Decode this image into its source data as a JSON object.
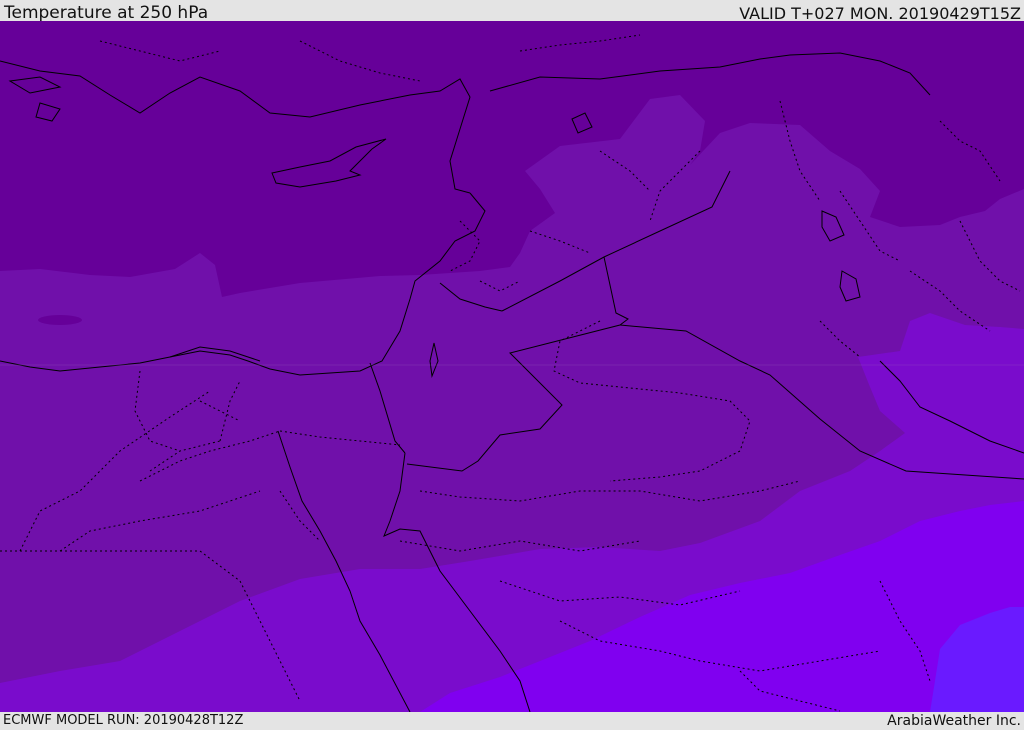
{
  "header": {
    "title": "Temperature at 250 hPa",
    "valid": "VALID T+027 MON. 20190429T15Z"
  },
  "footer": {
    "model_run": "ECMWF MODEL RUN: 20190428T12Z",
    "credit": "ArabiaWeather Inc."
  },
  "colors": {
    "band_coldest": "#660099",
    "band_cold": "#7010aa",
    "band_mid": "#7a0ccc",
    "band_warm": "#8000f0",
    "band_warmest": "#6a1aff",
    "coastline": "#000000",
    "border": "#000000",
    "background": "#e4e4e4"
  }
}
